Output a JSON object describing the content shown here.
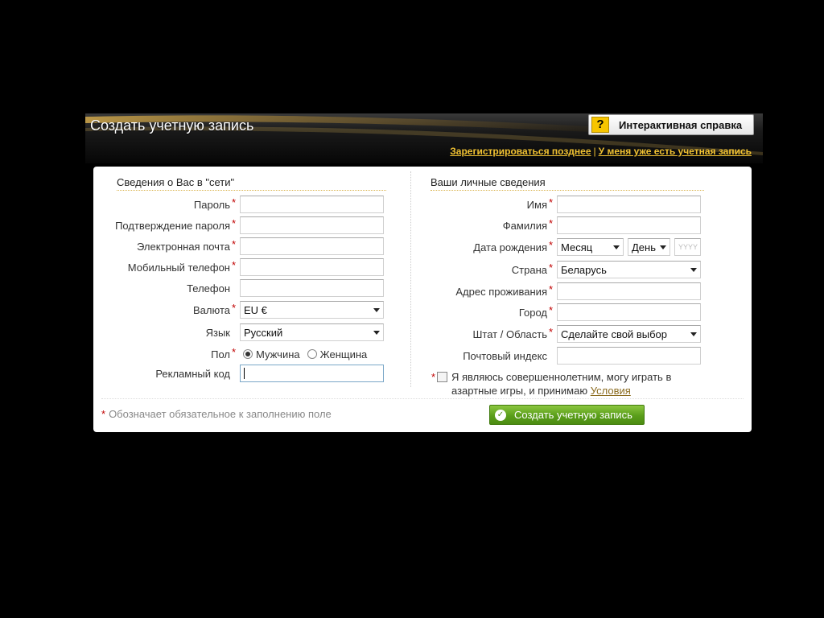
{
  "header": {
    "title": "Создать учетную запись",
    "help_label": "Интерактивная справка",
    "help_icon_glyph": "?",
    "link_later": "Зарегистрироваться позднее",
    "link_separator": "|",
    "link_have_account": "У меня уже есть учетная запись"
  },
  "online": {
    "section_title": "Сведения о Вас в \"сети\"",
    "password_label": "Пароль",
    "password_confirm_label": "Подтверждение пароля",
    "email_label": "Электронная почта",
    "mobile_label": "Мобильный телефон",
    "phone_label": "Телефон",
    "currency_label": "Валюта",
    "currency_value": "EU €",
    "language_label": "Язык",
    "language_value": "Русский",
    "gender_label": "Пол",
    "gender_male": "Мужчина",
    "gender_female": "Женщина",
    "gender_selected": "male",
    "promo_label": "Рекламный код"
  },
  "personal": {
    "section_title": "Ваши личные сведения",
    "first_name_label": "Имя",
    "last_name_label": "Фамилия",
    "dob_label": "Дата рождения",
    "dob_month": "Месяц",
    "dob_day": "День",
    "dob_year_placeholder": "YYYY",
    "country_label": "Страна",
    "country_value": "Беларусь",
    "address_label": "Адрес проживания",
    "city_label": "Город",
    "state_label": "Штат / Область",
    "state_value": "Сделайте свой выбор",
    "zip_label": "Почтовый индекс",
    "terms_text": "Я являюсь совершеннолетним, могу играть в азартные игры, и принимаю",
    "terms_link": "Условия"
  },
  "footer": {
    "required_star": "*",
    "required_note": "Обозначает обязательное к заполнению поле",
    "create_button": "Создать учетную запись"
  },
  "colors": {
    "accent_gold": "#f1c232",
    "required_red": "#c00000",
    "button_green": "#5a9e1a"
  },
  "icons": {
    "help": "question-mark-icon",
    "create": "check-circle-icon",
    "dropdown": "triangle-down-icon"
  }
}
